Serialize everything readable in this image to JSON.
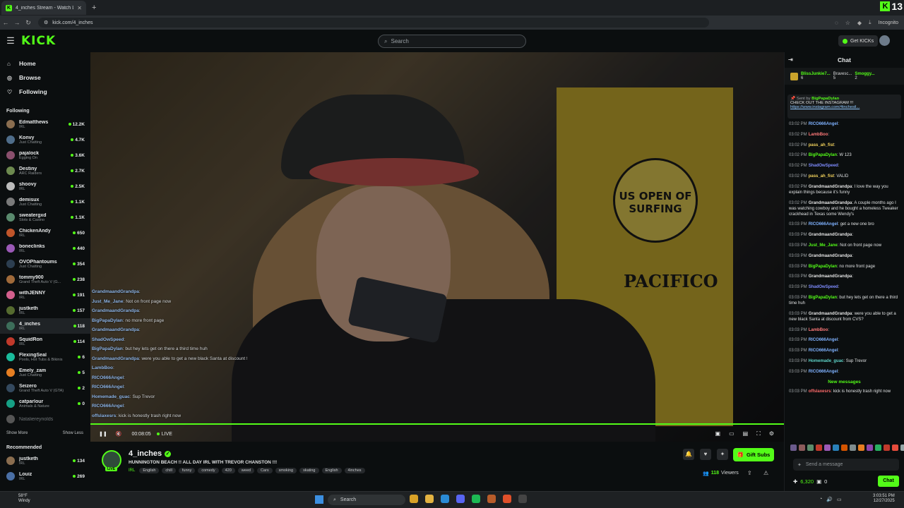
{
  "browser": {
    "tab_title": "4_inches Stream - Watch Li",
    "url": "kick.com/4_inches",
    "incognito_label": "Incognito",
    "extension_count": "13"
  },
  "header": {
    "logo": "KICK",
    "search_placeholder": "Search",
    "get_kicks_label": "Get KICKs"
  },
  "sidebar": {
    "nav": [
      {
        "label": "Home",
        "icon": "home-icon"
      },
      {
        "label": "Browse",
        "icon": "compass-icon"
      },
      {
        "label": "Following",
        "icon": "heart-icon"
      }
    ],
    "following_title": "Following",
    "following": [
      {
        "name": "Edmatthews",
        "category": "IRL",
        "viewers": "12.2K"
      },
      {
        "name": "Konvy",
        "category": "Just Chatting",
        "viewers": "4.7K"
      },
      {
        "name": "pajalock",
        "category": "Egging On",
        "viewers": "3.6K"
      },
      {
        "name": "Destiny",
        "category": "ARC Raiders",
        "viewers": "2.7K"
      },
      {
        "name": "shoovy",
        "category": "IRL",
        "viewers": "2.5K"
      },
      {
        "name": "demisux",
        "category": "Just Chatting",
        "viewers": "1.1K"
      },
      {
        "name": "sweatergxd",
        "category": "Slots & Casino",
        "viewers": "1.1K"
      },
      {
        "name": "ChickenAndy",
        "category": "IRL",
        "viewers": "650"
      },
      {
        "name": "boneclinks",
        "category": "IRL",
        "viewers": "440"
      },
      {
        "name": "OVOPhantoums",
        "category": "Just Chatting",
        "viewers": "354"
      },
      {
        "name": "tommy900",
        "category": "Grand Theft Auto V (G...",
        "viewers": "238"
      },
      {
        "name": "withJENNY",
        "category": "IRL",
        "viewers": "191"
      },
      {
        "name": "justketh",
        "category": "IRL",
        "viewers": "157"
      },
      {
        "name": "4_inches",
        "category": "IRL",
        "viewers": "118"
      },
      {
        "name": "SquidRon",
        "category": "IRL",
        "viewers": "114"
      },
      {
        "name": "FlexingSeal",
        "category": "Pools, Hot Tubs & Bikinis",
        "viewers": "6"
      },
      {
        "name": "Emely_zam",
        "category": "Just Chatting",
        "viewers": "5"
      },
      {
        "name": "Seizero",
        "category": "Grand Theft Auto V (GTA)",
        "viewers": "2"
      },
      {
        "name": "catparlour",
        "category": "Animals & Nature",
        "viewers": "0"
      }
    ],
    "offline_name": "Nataliereynolds",
    "show_more": "Show More",
    "show_less": "Show Less",
    "recommended_title": "Recommended",
    "recommended": [
      {
        "name": "justketh",
        "category": "IRL",
        "viewers": "134"
      },
      {
        "name": "Louiz",
        "category": "IRL",
        "viewers": "269"
      }
    ]
  },
  "video": {
    "sign_text": "US OPEN OF SURFING",
    "sign_text2": "PACIFICO",
    "time": "00:08:05",
    "live_label": "LIVE",
    "overlay_chat": [
      {
        "user": "GrandmaandGrandpa",
        "text": ""
      },
      {
        "user": "Just_Me_Jane",
        "text": "Not on front page now"
      },
      {
        "user": "GrandmaandGrandpa",
        "text": ""
      },
      {
        "user": "BigPapaDylan",
        "text": "no more front page"
      },
      {
        "user": "GrandmaandGrandpa",
        "text": ""
      },
      {
        "user": "ShadOwSpeed",
        "text": ""
      },
      {
        "user": "BigPapaDylan",
        "text": "but hey lets get on there a third time huh"
      },
      {
        "user": "GrandmaandGrandpa",
        "text": "were you able to get a new black Santa at discount from CVS?"
      },
      {
        "user": "LambBoo",
        "text": ""
      },
      {
        "user": "RICO666Angel",
        "text": ""
      },
      {
        "user": "RICO666Angel",
        "text": ""
      },
      {
        "user": "Homemade_guac",
        "text": "Sup Trevor"
      },
      {
        "user": "RICO666Angel",
        "text": ""
      },
      {
        "user": "offslaxesrs",
        "text": "kick is honestly trash right now"
      }
    ]
  },
  "stream": {
    "channel": "4_inches",
    "live_badge": "LIVE",
    "title": "HUNNINGTON BEACH !! ALL DAY IRL WITH TREVOR CHANSTON !!!",
    "category": "IRL",
    "tags": [
      "English",
      "chill",
      "funny",
      "comedy",
      "420",
      "weed",
      "Cars",
      "smoking",
      "skating",
      "English",
      "4inches"
    ],
    "gift_subs": "Gift Subs",
    "viewers_count": "118",
    "viewers_label": "Viewers"
  },
  "chat": {
    "title": "Chat",
    "leaderboard": [
      {
        "user": "BlissJunkie7...",
        "count": "6"
      },
      {
        "user": "Bravesc...",
        "count": "5"
      },
      {
        "user": "Smoggy...",
        "count": "2"
      }
    ],
    "pinned": {
      "sent_by_label": "Sent by",
      "sent_by_user": "BigPapaDylan",
      "text": "CHECK OUT THE INSTAGRAM !!!",
      "link": "https://www.instagram.com/4inchesil..."
    },
    "messages": [
      {
        "time": "03:02 PM",
        "user": "RICO666Angel",
        "text": "",
        "color": "#7fb2ff"
      },
      {
        "time": "03:02 PM",
        "user": "LambBoo",
        "text": "",
        "color": "#ff7a7a"
      },
      {
        "time": "03:02 PM",
        "user": "pass_ah_fist",
        "text": "",
        "color": "#f2d25c"
      },
      {
        "time": "03:02 PM",
        "user": "BigPapaDylan",
        "text": "W 123",
        "color": "#53fc18"
      },
      {
        "time": "03:02 PM",
        "user": "ShadOwSpeed",
        "text": "",
        "color": "#7f8cff"
      },
      {
        "time": "03:02 PM",
        "user": "pass_ah_fist",
        "text": "VALID",
        "color": "#f2d25c"
      },
      {
        "time": "03:02 PM",
        "user": "GrandmaandGrandpa",
        "text": "I love the way you explain things because it's funny",
        "color": "#e0e0e0"
      },
      {
        "time": "03:02 PM",
        "user": "GrandmaandGrandpa",
        "text": "A couple months ago I was watching cowboy and he bought a homeless Tweaker crackhead in Texas some Wendy's",
        "color": "#e0e0e0"
      },
      {
        "time": "03:03 PM",
        "user": "RICO666Angel",
        "text": "get a new one bro",
        "color": "#7fb2ff"
      },
      {
        "time": "03:03 PM",
        "user": "GrandmaandGrandpa",
        "text": "",
        "color": "#e0e0e0"
      },
      {
        "time": "03:03 PM",
        "user": "Just_Me_Jane",
        "text": "Not on front page now",
        "color": "#53fc18"
      },
      {
        "time": "03:03 PM",
        "user": "GrandmaandGrandpa",
        "text": "",
        "color": "#e0e0e0"
      },
      {
        "time": "03:03 PM",
        "user": "BigPapaDylan",
        "text": "no more front page",
        "color": "#53fc18"
      },
      {
        "time": "03:03 PM",
        "user": "GrandmaandGrandpa",
        "text": "",
        "color": "#e0e0e0"
      },
      {
        "time": "03:03 PM",
        "user": "ShadOwSpeed",
        "text": "",
        "color": "#7f8cff"
      },
      {
        "time": "03:03 PM",
        "user": "BigPapaDylan",
        "text": "but hey lets get on there a third time huh",
        "color": "#53fc18"
      },
      {
        "time": "03:03 PM",
        "user": "GrandmaandGrandpa",
        "text": "were you able to get a new black Santa at discount from CVS?",
        "color": "#e0e0e0"
      },
      {
        "time": "03:03 PM",
        "user": "LambBoo",
        "text": "",
        "color": "#ff7a7a"
      },
      {
        "time": "03:03 PM",
        "user": "RICO666Angel",
        "text": "",
        "color": "#7fb2ff"
      },
      {
        "time": "03:03 PM",
        "user": "RICO666Angel",
        "text": "",
        "color": "#7fb2ff"
      },
      {
        "time": "03:03 PM",
        "user": "Homemade_guac",
        "text": "Sup Trevor",
        "color": "#5ed3c8"
      },
      {
        "time": "03:03 PM",
        "user": "RICO666Angel",
        "text": "",
        "color": "#7fb2ff"
      }
    ],
    "new_messages_label": "New messages",
    "last_message": {
      "time": "03:03 PM",
      "user": "offslaxesrs",
      "text": "kick is honestly trash right now",
      "color": "#ff6b6b"
    },
    "input_placeholder": "Send a message",
    "points": "6,320",
    "zero_count": "0",
    "send_label": "Chat"
  },
  "taskbar": {
    "temp": "58°F",
    "weather": "Windy",
    "search": "Search",
    "time": "3:03:51 PM",
    "date": "12/27/2025"
  }
}
